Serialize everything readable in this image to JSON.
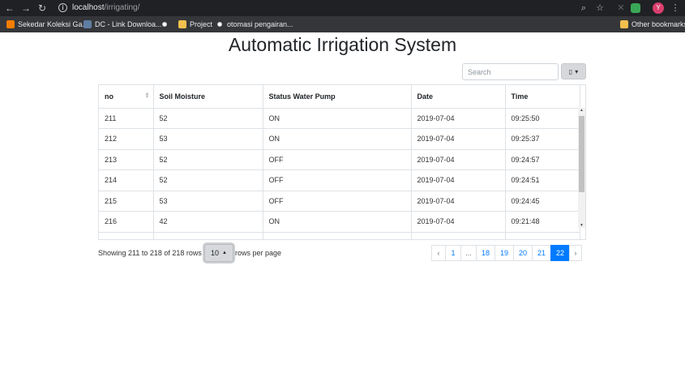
{
  "browser": {
    "url_host": "localhost",
    "url_path": "/irrigating/",
    "avatar_letter": "Y",
    "bookmarks": [
      {
        "label": "Sekedar Koleksi Ga...",
        "icon": "blogger-icon"
      },
      {
        "label": "DC - Link Downloa...",
        "icon": "site-icon"
      },
      {
        "label": "",
        "icon": "globe-icon"
      },
      {
        "label": "Project",
        "icon": "folder-icon"
      },
      {
        "label": "otomasi pengairan...",
        "icon": "globe-icon"
      }
    ],
    "other_bookmarks": "Other bookmarks"
  },
  "page": {
    "title": "Automatic Irrigation System"
  },
  "toolbar": {
    "search_placeholder": "Search",
    "columns_icon": "▯",
    "columns_caret": "▾"
  },
  "table": {
    "columns": [
      "no",
      "Soil Moisture",
      "Status Water Pump",
      "Date",
      "Time"
    ],
    "rows": [
      [
        "211",
        "52",
        "ON",
        "2019-07-04",
        "09:25:50"
      ],
      [
        "212",
        "53",
        "ON",
        "2019-07-04",
        "09:25:37"
      ],
      [
        "213",
        "52",
        "OFF",
        "2019-07-04",
        "09:24:57"
      ],
      [
        "214",
        "52",
        "OFF",
        "2019-07-04",
        "09:24:51"
      ],
      [
        "215",
        "53",
        "OFF",
        "2019-07-04",
        "09:24:45"
      ],
      [
        "216",
        "42",
        "ON",
        "2019-07-04",
        "09:21:48"
      ],
      [
        "",
        "",
        "",
        "",
        ""
      ]
    ]
  },
  "footer": {
    "showing_text": "Showing 211 to 218 of 218 rows",
    "page_size": "10",
    "page_size_caret": "▲",
    "rows_per_page": "rows per page"
  },
  "pagination": {
    "prev": "‹",
    "next": "›",
    "pages": [
      "1",
      "...",
      "18",
      "19",
      "20",
      "21",
      "22"
    ],
    "active": "22"
  }
}
